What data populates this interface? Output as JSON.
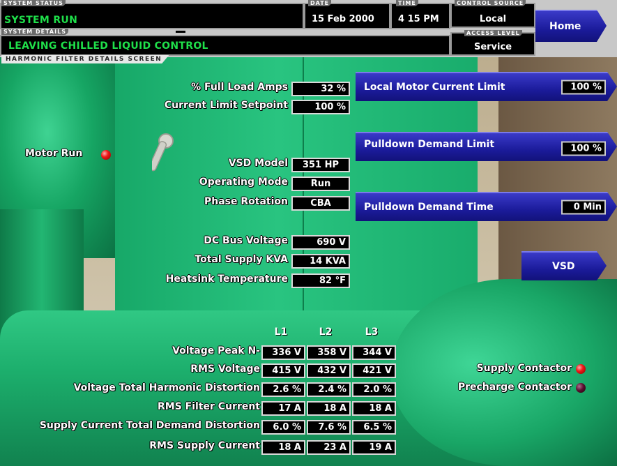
{
  "header": {
    "system_status_tab": "SYSTEM STATUS",
    "system_status": "SYSTEM RUN",
    "system_details_tab": "SYSTEM DETAILS",
    "system_details": "LEAVING CHILLED LIQUID CONTROL",
    "date_tab": "DATE",
    "date": "15 Feb 2000",
    "time_tab": "TIME",
    "time": "4 15 PM",
    "control_source_tab": "CONTROL SOURCE",
    "control_source": "Local",
    "access_level_tab": "ACCESS LEVEL",
    "access_level": "Service",
    "screen_title": "HARMONIC FILTER DETAILS SCREEN"
  },
  "nav": {
    "home": "Home",
    "vsd": "VSD"
  },
  "setpoints": [
    {
      "label": "Local Motor Current Limit",
      "value": "100 %"
    },
    {
      "label": "Pulldown Demand Limit",
      "value": "100 %"
    },
    {
      "label": "Pulldown Demand Time",
      "value": "0 Min"
    }
  ],
  "readings": {
    "full_load_amps": {
      "label": "% Full Load Amps",
      "value": "32 %"
    },
    "current_limit_setpoint": {
      "label": "Current Limit Setpoint",
      "value": "100 %"
    },
    "vsd_model": {
      "label": "VSD Model",
      "value": "351 HP"
    },
    "operating_mode": {
      "label": "Operating Mode",
      "value": "Run"
    },
    "phase_rotation": {
      "label": "Phase Rotation",
      "value": "CBA"
    },
    "dc_bus_voltage": {
      "label": "DC Bus Voltage",
      "value": "690 V"
    },
    "total_supply_kva": {
      "label": "Total Supply KVA",
      "value": "14 KVA"
    },
    "heatsink_temperature": {
      "label": "Heatsink Temperature",
      "value": "82 °F"
    }
  },
  "indicators": {
    "motor_run": {
      "label": "Motor Run",
      "color": "#f01818"
    },
    "supply_contactor": {
      "label": "Supply Contactor",
      "color": "#f01818"
    },
    "precharge_contactor": {
      "label": "Precharge Contactor",
      "color": "#5a1030"
    }
  },
  "phase_table": {
    "columns": [
      "L1",
      "L2",
      "L3"
    ],
    "rows": [
      {
        "label": "Voltage Peak N-",
        "values": [
          "336 V",
          "358 V",
          "344 V"
        ]
      },
      {
        "label": "RMS Voltage",
        "values": [
          "415 V",
          "432 V",
          "421 V"
        ]
      },
      {
        "label": "Voltage Total Harmonic Distortion",
        "values": [
          "2.6 %",
          "2.4 %",
          "2.0 %"
        ]
      },
      {
        "label": "RMS Filter Current",
        "values": [
          "17 A",
          "18 A",
          "18 A"
        ]
      },
      {
        "label": "Supply Current Total Demand Distortion",
        "values": [
          "6.0 %",
          "7.6 %",
          "6.5 %"
        ]
      },
      {
        "label": "RMS Supply Current",
        "values": [
          "18 A",
          "23 A",
          "19 A"
        ]
      }
    ]
  },
  "colors": {
    "status_green": "#1fe04a",
    "button_navy": "#1b1b9a",
    "chiller_green": "#1cae6c"
  }
}
